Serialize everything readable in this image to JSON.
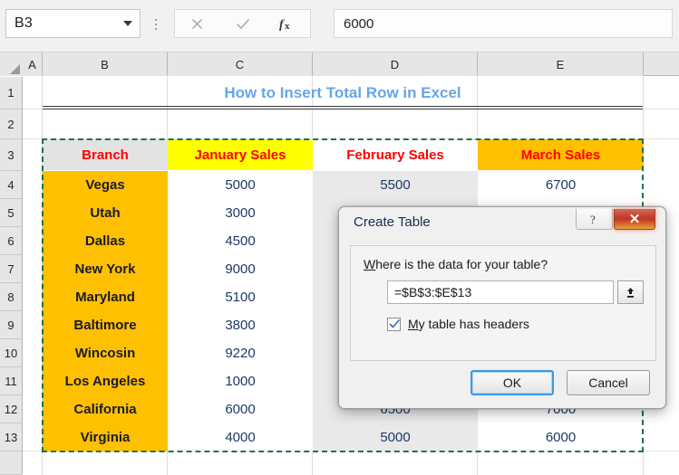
{
  "formula_bar": {
    "name_box_value": "B3",
    "name_box_caret": "chevron-down-icon",
    "cancel_icon": "x-icon",
    "enter_icon": "check-icon",
    "function_icon": "fx-icon",
    "formula_value": "6000"
  },
  "grid": {
    "column_headers": [
      "A",
      "B",
      "C",
      "D",
      "E"
    ],
    "row_headers": [
      "1",
      "2",
      "3",
      "4",
      "5",
      "6",
      "7",
      "8",
      "9",
      "10",
      "11",
      "12",
      "13"
    ],
    "title": "How to Insert Total Row in Excel",
    "table_headers": [
      "Branch",
      "January Sales",
      "February Sales",
      "March Sales"
    ],
    "rows": [
      {
        "branch": "Vegas",
        "january": "5000",
        "february": "5500",
        "march": "6700"
      },
      {
        "branch": "Utah",
        "january": "3000",
        "february": "",
        "march": ""
      },
      {
        "branch": "Dallas",
        "january": "4500",
        "february": "",
        "march": ""
      },
      {
        "branch": "New York",
        "january": "9000",
        "february": "",
        "march": ""
      },
      {
        "branch": "Maryland",
        "january": "5100",
        "february": "",
        "march": ""
      },
      {
        "branch": "Baltimore",
        "january": "3800",
        "february": "",
        "march": ""
      },
      {
        "branch": "Wincosin",
        "january": "9220",
        "february": "",
        "march": ""
      },
      {
        "branch": "Los Angeles",
        "january": "1000",
        "february": "",
        "march": ""
      },
      {
        "branch": "California",
        "january": "6000",
        "february": "6500",
        "march": "7000"
      },
      {
        "branch": "Virginia",
        "january": "4000",
        "february": "5000",
        "march": "6000"
      }
    ],
    "selection_range_label": "B3:E13"
  },
  "dialog": {
    "title": "Create Table",
    "help_icon": "question-mark-icon",
    "close_icon": "close-icon",
    "prompt_underlined": "W",
    "prompt_rest": "here is the data for your table?",
    "range_value": "=$B$3:$E$13",
    "range_picker_icon": "collapse-dialog-icon",
    "checkbox_checked": true,
    "checkbox_underlined": "M",
    "checkbox_rest": "y table has headers",
    "ok_label": "OK",
    "cancel_label": "Cancel"
  },
  "colors": {
    "title_blue": "#65a6e8",
    "header_red": "#ff0000",
    "branch_orange": "#ffc000",
    "january_yellow": "#ffff00",
    "marching_ants_green": "#217346",
    "number_navy": "#1f3864"
  }
}
